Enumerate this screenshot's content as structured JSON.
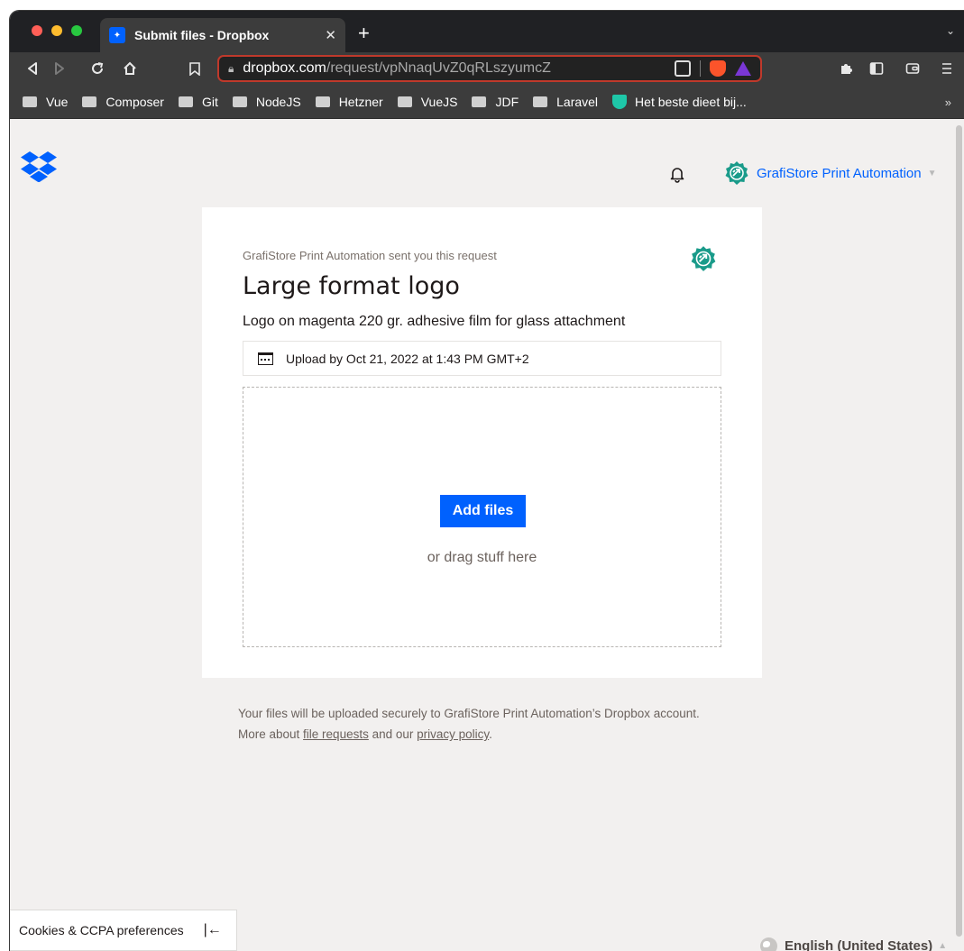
{
  "browser": {
    "tab_title": "Submit files - Dropbox",
    "tab_close": "✕",
    "new_tab": "+",
    "tab_menu": "⌄",
    "url_host": "dropbox.com",
    "url_path": "/request/vpNnaqUvZ0qRLszyumcZ",
    "bookmarks": [
      "Vue",
      "Composer",
      "Git",
      "NodeJS",
      "Hetzner",
      "VueJS",
      "JDF",
      "Laravel",
      "Het beste dieet bij..."
    ],
    "bookmarks_more": "»"
  },
  "header": {
    "account_name": "GrafiStore Print Automation"
  },
  "request": {
    "sent_by": "GrafiStore Print Automation sent you this request",
    "title": "Large format logo",
    "description": "Logo on magenta 220 gr. adhesive film for glass attachment",
    "deadline": "Upload by Oct 21, 2022 at 1:43 PM GMT+2",
    "add_files": "Add files",
    "drag_text": "or drag stuff here"
  },
  "footnote": {
    "text_1": "Your files will be uploaded securely to GrafiStore Print Automation’s Dropbox account. More about ",
    "link_file_requests": "file requests",
    "text_2": " and our ",
    "link_privacy": "privacy policy",
    "text_3": "."
  },
  "footer": {
    "cookies": "Cookies & CCPA preferences",
    "cookies_collapse": "|←",
    "language": "English (United States)"
  },
  "colors": {
    "dropbox_blue": "#0061fe",
    "avatar_teal": "#1a9b8a",
    "url_border": "#c0392b"
  }
}
